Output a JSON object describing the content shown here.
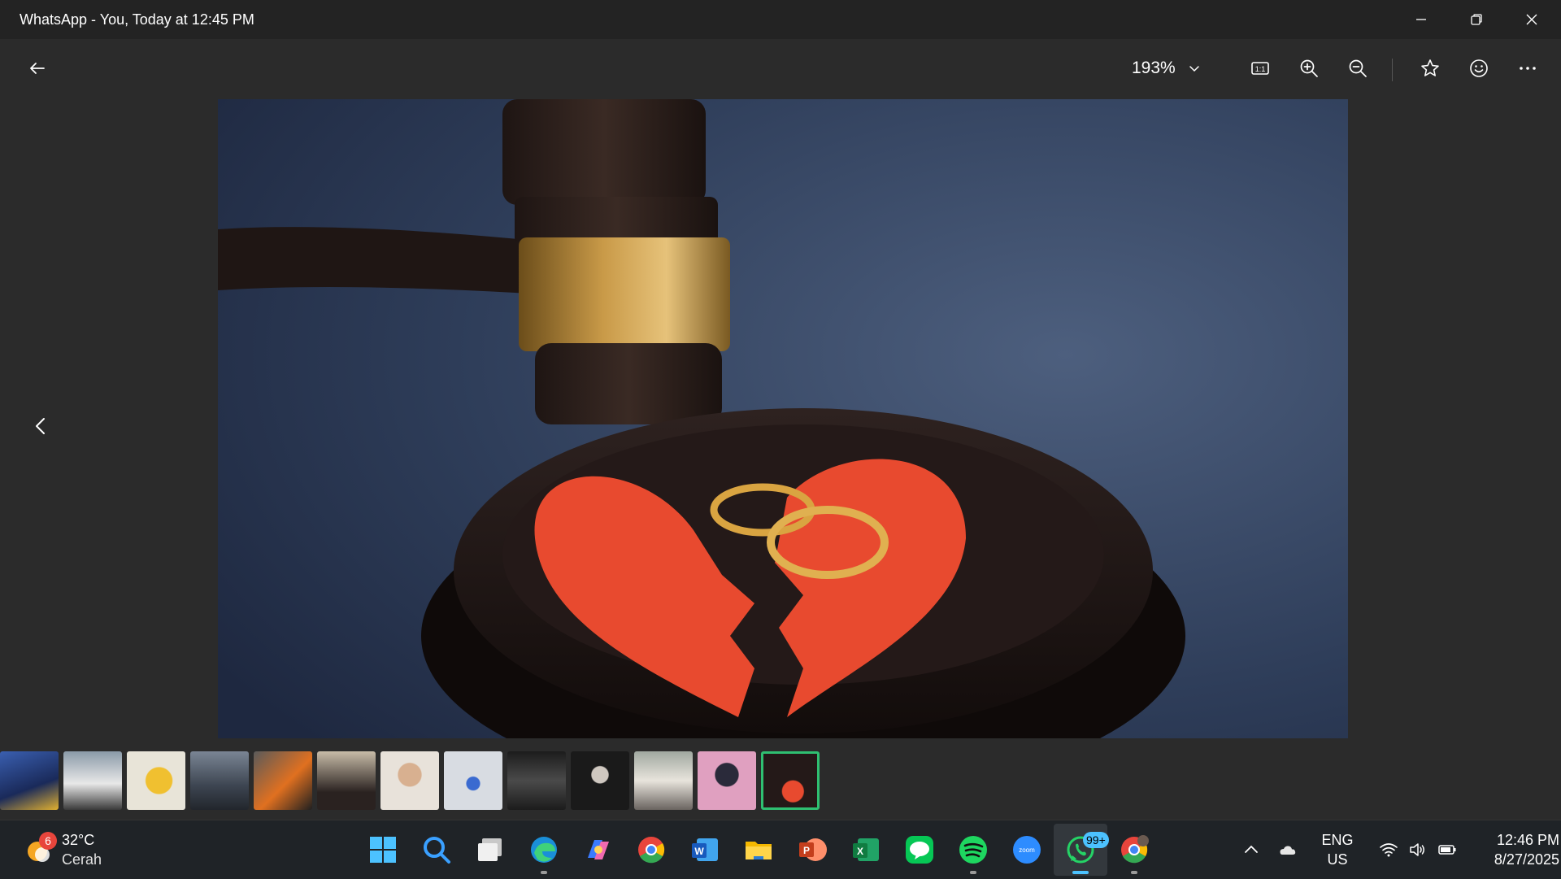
{
  "window": {
    "title": "WhatsApp - You, Today at 12:45 PM",
    "controls": [
      "minimize-icon",
      "restore-icon",
      "close-icon"
    ]
  },
  "toolbar": {
    "zoom_value": "193%",
    "icons": [
      "back-arrow-icon",
      "chevron-down-icon",
      "actual-size-icon",
      "zoom-in-icon",
      "zoom-out-icon",
      "star-icon",
      "emoji-icon",
      "more-icon"
    ]
  },
  "viewer": {
    "image_subject": "judge gavel with broken red heart and two gold rings",
    "thumbnail_count": 13,
    "selected_thumbnail": 13
  },
  "taskbar": {
    "weather": {
      "temp": "32°C",
      "condition": "Cerah",
      "badge": "6"
    },
    "apps": [
      "start",
      "search",
      "task-view",
      "edge",
      "copilot",
      "chrome",
      "word",
      "file-explorer",
      "powerpoint",
      "excel",
      "line",
      "spotify",
      "zoom",
      "whatsapp",
      "chrome-profile"
    ],
    "whatsapp_badge": "99+",
    "language": {
      "line1": "ENG",
      "line2": "US"
    },
    "clock": {
      "time": "12:46 PM",
      "date": "8/27/2025"
    }
  },
  "colors": {
    "accent": "#4cc2ff",
    "selected_border": "#2fbf71",
    "background": "#2b2b2b",
    "taskbar": "#1f2327"
  }
}
